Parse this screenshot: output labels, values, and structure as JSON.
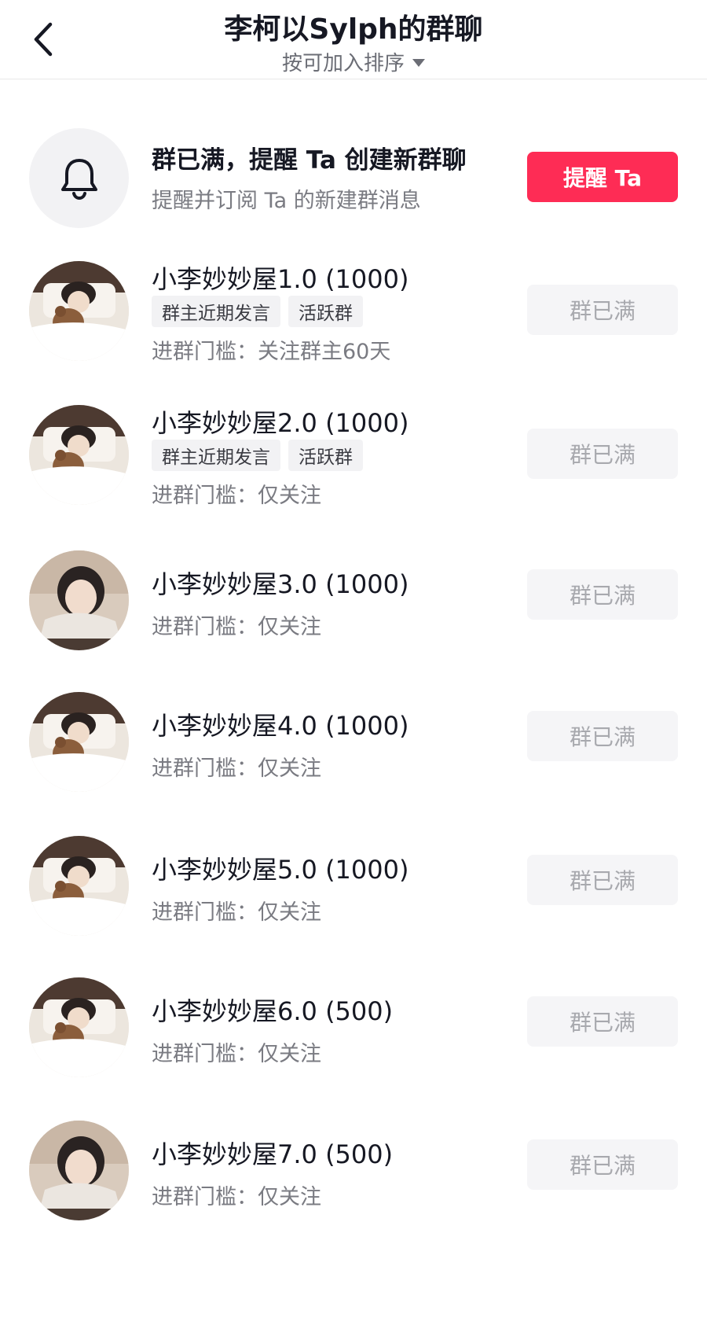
{
  "header": {
    "title": "李柯以Sylph的群聊",
    "sort_label": "按可加入排序"
  },
  "notify": {
    "title": "群已满，提醒 Ta 创建新群聊",
    "subtitle": "提醒并订阅 Ta 的新建群消息",
    "button_label": "提醒 Ta"
  },
  "groups": [
    {
      "name": "小李妙妙屋1.0 (1000)",
      "tags": [
        "群主近期发言",
        "活跃群"
      ],
      "condition": "进群门槛：关注群主60天",
      "button": "群已满",
      "avatar": "bed-bear"
    },
    {
      "name": "小李妙妙屋2.0 (1000)",
      "tags": [
        "群主近期发言",
        "活跃群"
      ],
      "condition": "进群门槛：仅关注",
      "button": "群已满",
      "avatar": "bed-bear"
    },
    {
      "name": "小李妙妙屋3.0 (1000)",
      "tags": [],
      "condition": "进群门槛：仅关注",
      "button": "群已满",
      "avatar": "portrait"
    },
    {
      "name": "小李妙妙屋4.0 (1000)",
      "tags": [],
      "condition": "进群门槛：仅关注",
      "button": "群已满",
      "avatar": "bed-bear"
    },
    {
      "name": "小李妙妙屋5.0 (1000)",
      "tags": [],
      "condition": "进群门槛：仅关注",
      "button": "群已满",
      "avatar": "bed-bear"
    },
    {
      "name": "小李妙妙屋6.0 (500)",
      "tags": [],
      "condition": "进群门槛：仅关注",
      "button": "群已满",
      "avatar": "bed-bear"
    },
    {
      "name": "小李妙妙屋7.0 (500)",
      "tags": [],
      "condition": "进群门槛：仅关注",
      "button": "群已满",
      "avatar": "portrait"
    }
  ],
  "colors": {
    "accent": "#fe2c55",
    "text_primary": "#161823",
    "text_secondary": "#7a7b82",
    "disabled_button_bg": "#f5f5f7",
    "disabled_button_text": "#a8a9ae"
  },
  "icons": {
    "back": "chevron-left-icon",
    "bell": "bell-icon",
    "sort": "caret-down-icon"
  }
}
